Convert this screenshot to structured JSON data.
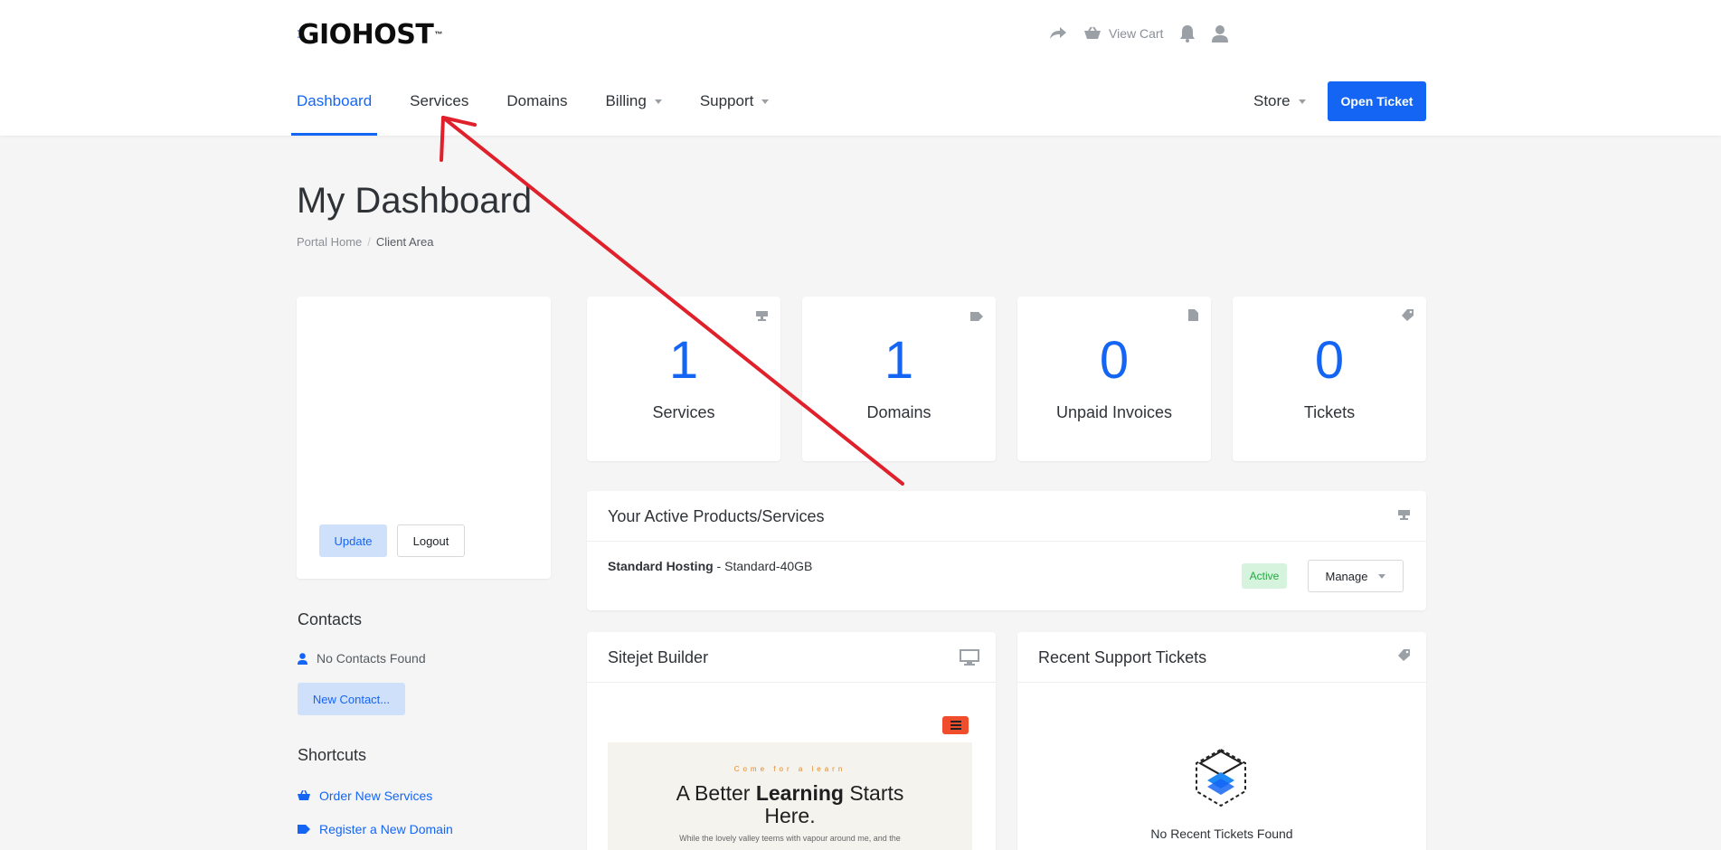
{
  "brand": {
    "name": "GIOHOST",
    "tm": "™"
  },
  "topbar": {
    "view_cart": "View Cart"
  },
  "nav": {
    "items": [
      {
        "label": "Dashboard",
        "active": true
      },
      {
        "label": "Services"
      },
      {
        "label": "Domains"
      },
      {
        "label": "Billing",
        "dropdown": true
      },
      {
        "label": "Support",
        "dropdown": true
      }
    ],
    "store": "Store",
    "open_ticket": "Open Ticket"
  },
  "page": {
    "title": "My Dashboard",
    "breadcrumb": [
      "Portal Home",
      "Client Area"
    ]
  },
  "profile": {
    "update": "Update",
    "logout": "Logout"
  },
  "stats": [
    {
      "value": "1",
      "label": "Services",
      "icon": "server-icon"
    },
    {
      "value": "1",
      "label": "Domains",
      "icon": "tag-icon"
    },
    {
      "value": "0",
      "label": "Unpaid Invoices",
      "icon": "file-icon"
    },
    {
      "value": "0",
      "label": "Tickets",
      "icon": "ticket-tag-icon"
    }
  ],
  "contacts": {
    "title": "Contacts",
    "empty": "No Contacts Found",
    "new_button": "New Contact..."
  },
  "shortcuts": {
    "title": "Shortcuts",
    "items": [
      "Order New Services",
      "Register a New Domain"
    ]
  },
  "products": {
    "title": "Your Active Products/Services",
    "name": "Standard Hosting",
    "plan": " - Standard-40GB",
    "status": "Active",
    "manage": "Manage"
  },
  "sitejet": {
    "title": "Sitejet Builder",
    "preview_kicker": "Come for a learn",
    "preview_headline_pre": "A Better ",
    "preview_headline_bold": "Learning",
    "preview_headline_post": " Starts",
    "preview_headline_line2": "Here.",
    "preview_sub": "While the lovely valley teems with vapour around me, and the"
  },
  "tickets": {
    "title": "Recent Support Tickets",
    "empty": "No Recent Tickets Found"
  },
  "colors": {
    "accent": "#1565f5",
    "annotation": "#e0202a",
    "success": "#28a745"
  }
}
